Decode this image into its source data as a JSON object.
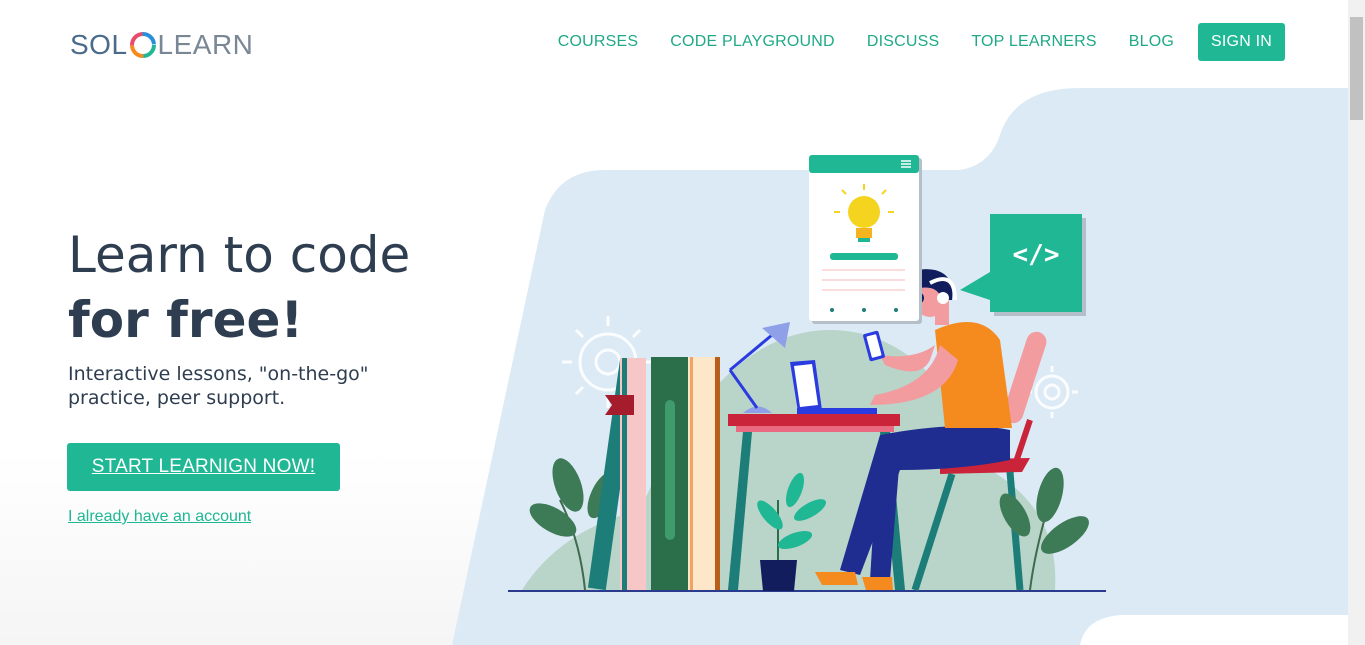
{
  "logo": {
    "part1": "SOL",
    "part2": "LEARN"
  },
  "nav": {
    "items": [
      {
        "label": "COURSES"
      },
      {
        "label": "CODE PLAYGROUND"
      },
      {
        "label": "DISCUSS"
      },
      {
        "label": "TOP LEARNERS"
      },
      {
        "label": "BLOG"
      }
    ],
    "signin_label": "SIGN IN"
  },
  "hero": {
    "title_line1": "Learn to code",
    "title_line2": "for free!",
    "subtitle": "Interactive lessons, \"on-the-go\" practice, peer support.",
    "cta_label": "START LEARNIGN NOW!",
    "login_link": "I already have an account"
  },
  "illustration": {
    "code_bubble_text": "</>"
  },
  "colors": {
    "accent": "#1fb794",
    "nav_text": "#1fa986",
    "heading": "#2e3d4f",
    "hero_bg": "#dbeaf5"
  }
}
